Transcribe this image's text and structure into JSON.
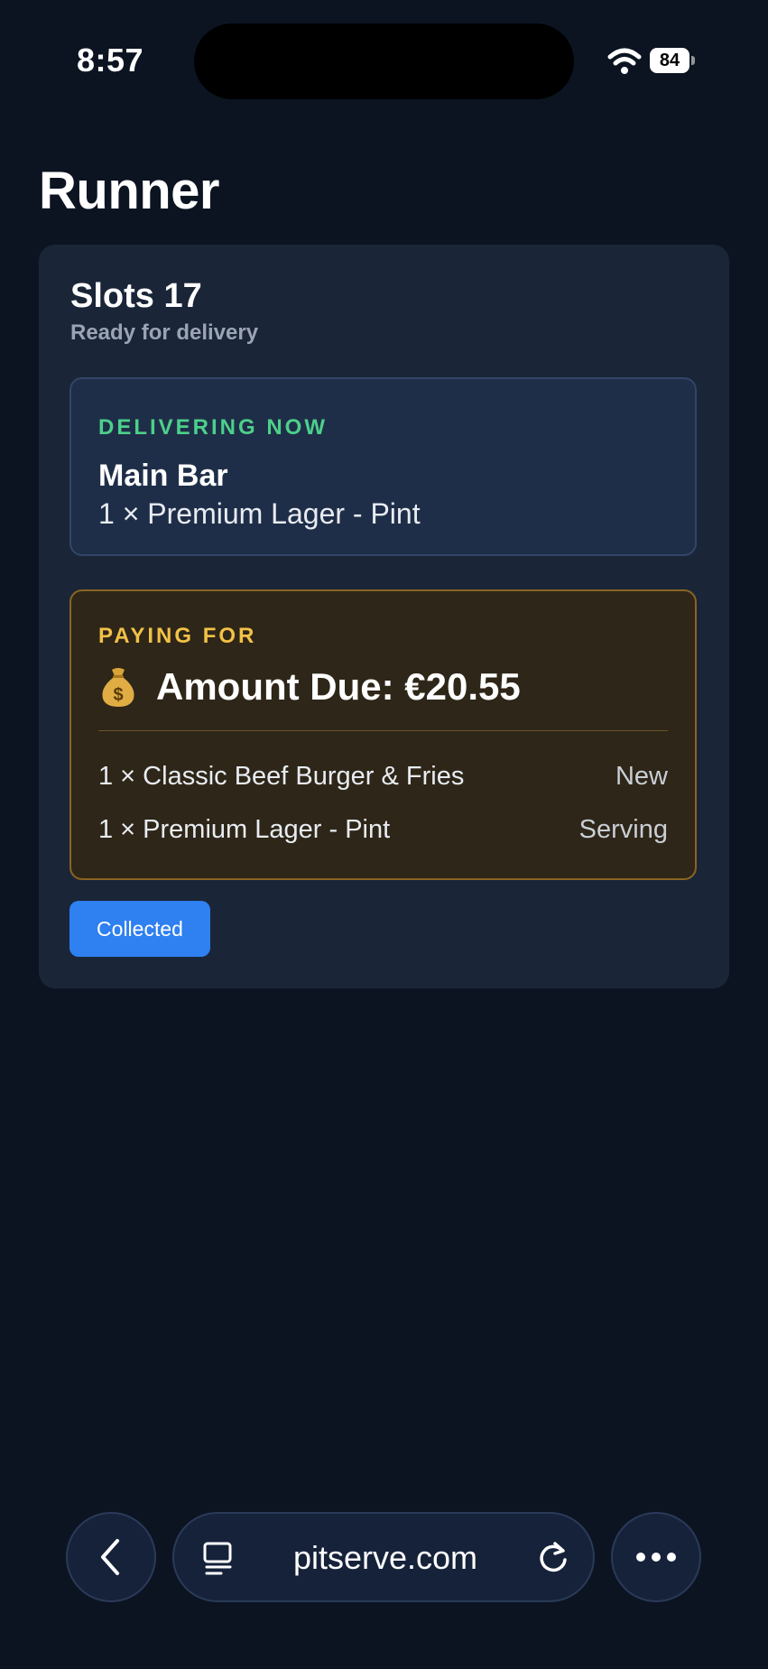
{
  "status_bar": {
    "time": "8:57",
    "battery": "84"
  },
  "page": {
    "title": "Runner"
  },
  "card": {
    "title": "Slots 17",
    "subtitle": "Ready for delivery",
    "delivering": {
      "label": "DELIVERING NOW",
      "venue": "Main Bar",
      "item": "1 × Premium Lager - Pint"
    },
    "paying": {
      "label": "PAYING FOR",
      "icon": "money-bag-icon",
      "amount": "Amount Due: €20.55",
      "items": [
        {
          "name": "1 × Classic Beef Burger & Fries",
          "status": "New"
        },
        {
          "name": "1 × Premium Lager - Pint",
          "status": "Serving"
        }
      ]
    },
    "collected_label": "Collected"
  },
  "browser": {
    "url": "pitserve.com",
    "icons": [
      "back-icon",
      "tabs-icon",
      "reload-icon",
      "more-icon"
    ]
  },
  "colors": {
    "background": "#0c1422",
    "card": "#1a2538",
    "delivering_accent": "#4cd08a",
    "paying_accent": "#f2c147",
    "button": "#2f80f0"
  }
}
